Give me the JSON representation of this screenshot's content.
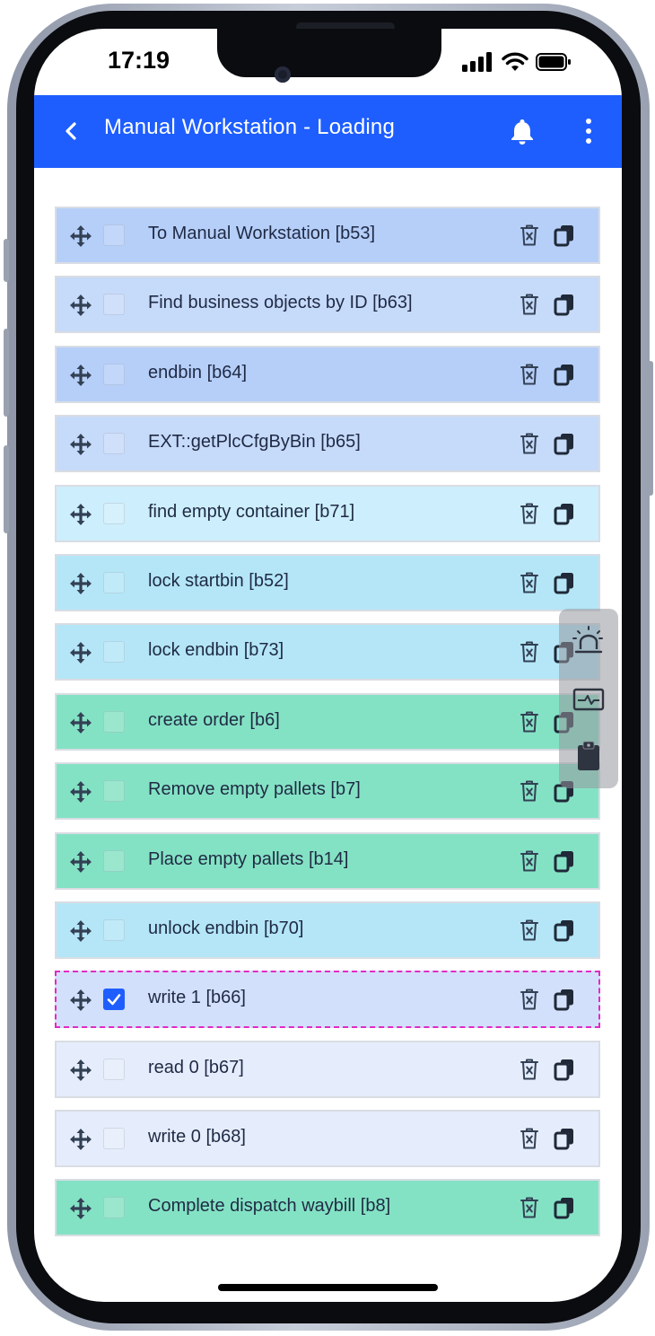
{
  "status_bar": {
    "time": "17:19"
  },
  "app_bar": {
    "title": "Manual Workstation - Loading",
    "background": "#1e5eff",
    "back_icon": "chevron-left-icon",
    "notification_icon": "bell-icon",
    "menu_icon": "more-vertical-icon"
  },
  "steps": [
    {
      "label": "To Manual Workstation [b53]",
      "color": "#b6cff9",
      "checked": false
    },
    {
      "label": "Find business objects by ID [b63]",
      "color": "#c6dafa",
      "checked": false
    },
    {
      "label": "endbin [b64]",
      "color": "#b6cff9",
      "checked": false
    },
    {
      "label": "EXT::getPlcCfgByBin [b65]",
      "color": "#c6dafa",
      "checked": false
    },
    {
      "label": "find empty container [b71]",
      "color": "#cdeefc",
      "checked": false
    },
    {
      "label": "lock startbin [b52]",
      "color": "#b4e6f7",
      "checked": false
    },
    {
      "label": "lock endbin [b73]",
      "color": "#b4e6f7",
      "checked": false
    },
    {
      "label": "create order [b6]",
      "color": "#84e2c4",
      "checked": false
    },
    {
      "label": "Remove empty pallets [b7]",
      "color": "#84e2c4",
      "checked": false
    },
    {
      "label": "Place empty pallets [b14]",
      "color": "#84e2c4",
      "checked": false
    },
    {
      "label": "unlock endbin [b70]",
      "color": "#b4e6f7",
      "checked": false
    },
    {
      "label": "write 1 [b66]",
      "color": "#d3e0fb",
      "checked": true
    },
    {
      "label": "read 0 [b67]",
      "color": "#e5edfc",
      "checked": false
    },
    {
      "label": "write 0 [b68]",
      "color": "#e5edfc",
      "checked": false
    },
    {
      "label": "Complete dispatch waybill [b8]",
      "color": "#84e2c4",
      "checked": false
    }
  ],
  "row_icons": {
    "drag": "move-icon",
    "delete": "trash-icon",
    "copy": "copy-icon"
  },
  "floating_toolbar": {
    "icons": [
      "alarm-light-icon",
      "monitor-pulse-icon",
      "clipboard-icon"
    ]
  },
  "accent_colors": {
    "selection_border": "#e02bc4",
    "checkbox_checked": "#1e5eff"
  }
}
